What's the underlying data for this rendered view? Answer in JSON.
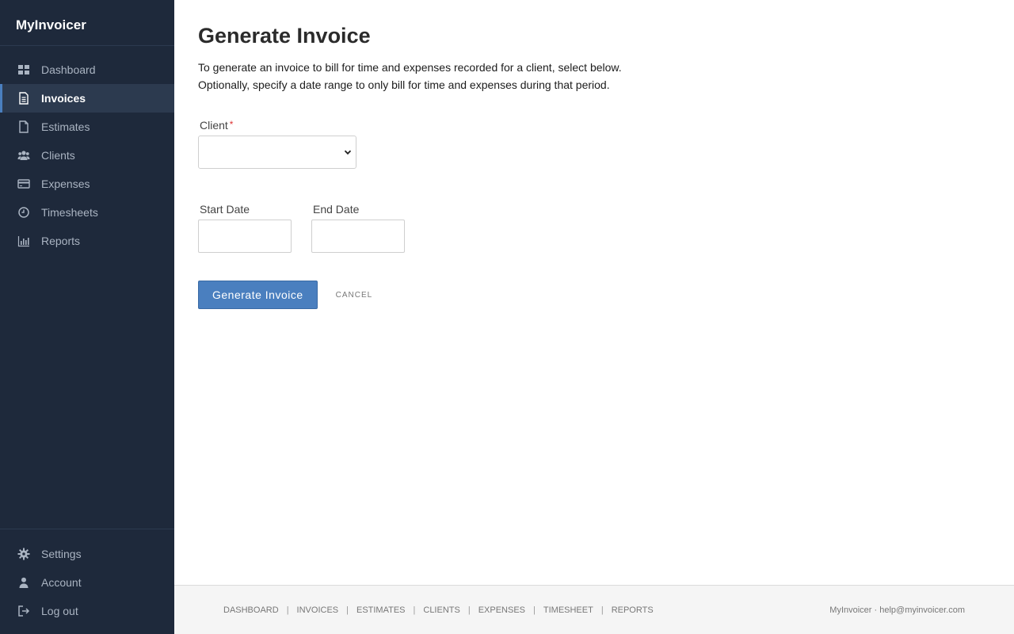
{
  "app": {
    "brand": "MyInvoicer"
  },
  "sidebar": {
    "items": [
      {
        "label": "Dashboard",
        "icon": "dashboard-icon"
      },
      {
        "label": "Invoices",
        "icon": "invoice-icon",
        "active": true
      },
      {
        "label": "Estimates",
        "icon": "document-icon"
      },
      {
        "label": "Clients",
        "icon": "users-icon"
      },
      {
        "label": "Expenses",
        "icon": "credit-card-icon"
      },
      {
        "label": "Timesheets",
        "icon": "clock-icon"
      },
      {
        "label": "Reports",
        "icon": "bar-chart-icon"
      }
    ],
    "bottom_items": [
      {
        "label": "Settings",
        "icon": "gear-icon"
      },
      {
        "label": "Account",
        "icon": "user-icon"
      },
      {
        "label": "Log out",
        "icon": "logout-icon"
      }
    ]
  },
  "main": {
    "title": "Generate Invoice",
    "intro_line1": "To generate an invoice to bill for time and expenses recorded for a client, select below.",
    "intro_line2": "Optionally, specify a date range to only bill for time and expenses during that period.",
    "client_label": "Client",
    "client_required_mark": "*",
    "client_value": "",
    "start_date_label": "Start Date",
    "start_date_value": "",
    "end_date_label": "End Date",
    "end_date_value": "",
    "generate_button": "Generate Invoice",
    "cancel_button": "CANCEL"
  },
  "footer": {
    "links": [
      "DASHBOARD",
      "INVOICES",
      "ESTIMATES",
      "CLIENTS",
      "EXPENSES",
      "TIMESHEET",
      "REPORTS"
    ],
    "separator": "|",
    "right_text": "MyInvoicer · help@myinvoicer.com"
  },
  "colors": {
    "sidebar_bg": "#1e293b",
    "sidebar_active_bg": "#2c3a4f",
    "accent": "#4a7fbf",
    "required": "#dd3333"
  }
}
